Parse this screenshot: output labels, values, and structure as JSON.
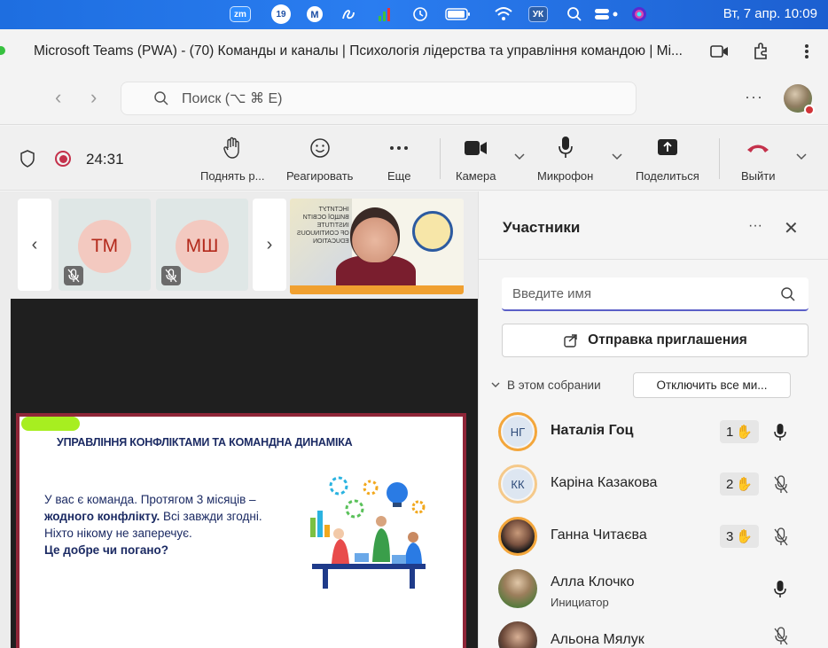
{
  "menubar": {
    "zoom_label": "zm",
    "badge_count": "19",
    "vk_label": "УК",
    "datetime": "Вт, 7 апр.  10:09"
  },
  "browser": {
    "window_title": "Microsoft Teams (PWA) - (70) Команды и каналы | Психологія лідерства та управління командою | Мі...",
    "search_placeholder": "Поиск (⌥ ⌘ E)"
  },
  "meeting_bar": {
    "timer": "24:31",
    "raise_hand_label": "Поднять р...",
    "react_label": "Реагировать",
    "more_label": "Еще",
    "camera_label": "Камера",
    "mic_label": "Микрофон",
    "share_label": "Поделиться",
    "leave_label": "Выйти"
  },
  "stage": {
    "thumbs": [
      {
        "initials": "ТМ"
      },
      {
        "initials": "МШ"
      }
    ],
    "video_bg_text": "ІНСТИТУТ\nВИЩОЇ ОСВІТИ\nINSTITUTE\nOF CONTINUOUS\nEDUCATION",
    "slide": {
      "heading": "УПРАВЛІННЯ КОНФЛІКТАМИ ТА КОМАНДНА ДИНАМІКА",
      "line1": "У вас є команда. Протягом 3 місяців –",
      "line2_bold": "жодного конфлікту.",
      "line2_rest": " Всі завжди згодні.",
      "line3": "Ніхто нікому не заперечує.",
      "line4": "Це добре чи погано?"
    }
  },
  "panel": {
    "title": "Участники",
    "search_placeholder": "Введите имя",
    "invite_label": "Отправка приглашения",
    "section_label": "В этом собрании",
    "mute_all_label": "Отключить все ми...",
    "participants": [
      {
        "initials": "НГ",
        "name": "Наталія Гоц",
        "hand": "1",
        "mic": "on"
      },
      {
        "initials": "КК",
        "name": "Каріна Казакова",
        "hand": "2",
        "mic": "off"
      },
      {
        "initials": "",
        "name": "Ганна Читаєва",
        "hand": "3",
        "mic": "off"
      },
      {
        "initials": "",
        "name": "Алла Клочко",
        "role": "Инициатор",
        "mic": "on"
      },
      {
        "initials": "",
        "name": "Альона Мялук",
        "mic": "off"
      }
    ]
  },
  "colors": {
    "accent": "#5b5fc7",
    "leave": "#c4314b",
    "slide_border": "#8f2638",
    "slide_text": "#1b2a63"
  }
}
